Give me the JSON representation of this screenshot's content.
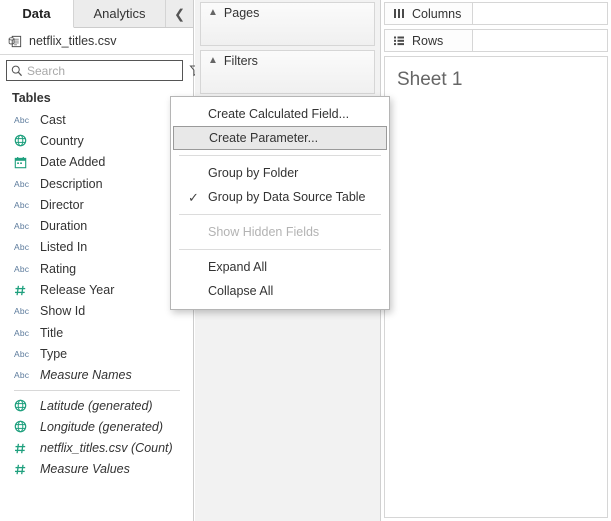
{
  "pane": {
    "tabs": [
      {
        "label": "Data",
        "active": true
      },
      {
        "label": "Analytics",
        "active": false
      }
    ],
    "collapse_icon": "chevron-left-icon",
    "datasource": {
      "icon": "data-source-icon",
      "name": "netflix_titles.csv"
    },
    "search": {
      "placeholder": "Search",
      "value": "",
      "icon": "search-icon",
      "filter_icon": "filter-funnel-icon",
      "menu_icon": "caret-down-icon"
    },
    "section_header": "Tables",
    "fields": [
      {
        "label": "Cast",
        "icon": "abc-string-icon",
        "icon_glyph": "Abc",
        "generated": false
      },
      {
        "label": "Country",
        "icon": "globe-geo-icon",
        "icon_glyph": "globe",
        "generated": false
      },
      {
        "label": "Date Added",
        "icon": "calendar-date-icon",
        "icon_glyph": "calendar",
        "generated": false
      },
      {
        "label": "Description",
        "icon": "abc-string-icon",
        "icon_glyph": "Abc",
        "generated": false
      },
      {
        "label": "Director",
        "icon": "abc-string-icon",
        "icon_glyph": "Abc",
        "generated": false
      },
      {
        "label": "Duration",
        "icon": "abc-string-icon",
        "icon_glyph": "Abc",
        "generated": false
      },
      {
        "label": "Listed In",
        "icon": "abc-string-icon",
        "icon_glyph": "Abc",
        "generated": false
      },
      {
        "label": "Rating",
        "icon": "abc-string-icon",
        "icon_glyph": "Abc",
        "generated": false
      },
      {
        "label": "Release Year",
        "icon": "hash-number-icon",
        "icon_glyph": "hash",
        "generated": false
      },
      {
        "label": "Show Id",
        "icon": "abc-string-icon",
        "icon_glyph": "Abc",
        "generated": false
      },
      {
        "label": "Title",
        "icon": "abc-string-icon",
        "icon_glyph": "Abc",
        "generated": false
      },
      {
        "label": "Type",
        "icon": "abc-string-icon",
        "icon_glyph": "Abc",
        "generated": false
      },
      {
        "label": "Measure Names",
        "icon": "abc-string-icon",
        "icon_glyph": "Abc",
        "generated": true
      }
    ],
    "measures": [
      {
        "label": "Latitude (generated)",
        "icon": "globe-geo-icon",
        "icon_glyph": "globe",
        "generated": true
      },
      {
        "label": "Longitude (generated)",
        "icon": "globe-geo-icon",
        "icon_glyph": "globe",
        "generated": true
      },
      {
        "label": "netflix_titles.csv (Count)",
        "icon": "hash-number-icon",
        "icon_glyph": "hash",
        "generated": true
      },
      {
        "label": "Measure Values",
        "icon": "hash-number-icon",
        "icon_glyph": "hash",
        "generated": true
      }
    ]
  },
  "shelves": {
    "pages": {
      "label": "Pages",
      "chevron": "chevron-up-icon"
    },
    "filters": {
      "label": "Filters",
      "chevron": "chevron-up-icon"
    },
    "columns": {
      "label": "Columns",
      "icon": "columns-icon"
    },
    "rows": {
      "label": "Rows",
      "icon": "rows-icon"
    }
  },
  "sheet": {
    "title": "Sheet 1"
  },
  "context_menu": {
    "items": [
      {
        "label": "Create Calculated Field...",
        "highlighted": false,
        "checked": false,
        "disabled": false
      },
      {
        "label": "Create Parameter...",
        "highlighted": true,
        "checked": false,
        "disabled": false
      },
      {
        "separator": true
      },
      {
        "label": "Group by Folder",
        "highlighted": false,
        "checked": false,
        "disabled": false
      },
      {
        "label": "Group by Data Source Table",
        "highlighted": false,
        "checked": true,
        "disabled": false
      },
      {
        "separator": true
      },
      {
        "label": "Show Hidden Fields",
        "highlighted": false,
        "checked": false,
        "disabled": true
      },
      {
        "separator": true
      },
      {
        "label": "Expand All",
        "highlighted": false,
        "checked": false,
        "disabled": false
      },
      {
        "label": "Collapse All",
        "highlighted": false,
        "checked": false,
        "disabled": false
      }
    ],
    "check_glyph": "✓"
  },
  "colors": {
    "dimension_icon": "#5c7b9c",
    "geo_icon": "#1fa07e",
    "measure_icon": "#1fa07e",
    "highlight_bg": "#e8e8e8",
    "pane_border": "#cccccc",
    "sheet_title": "#666666"
  }
}
